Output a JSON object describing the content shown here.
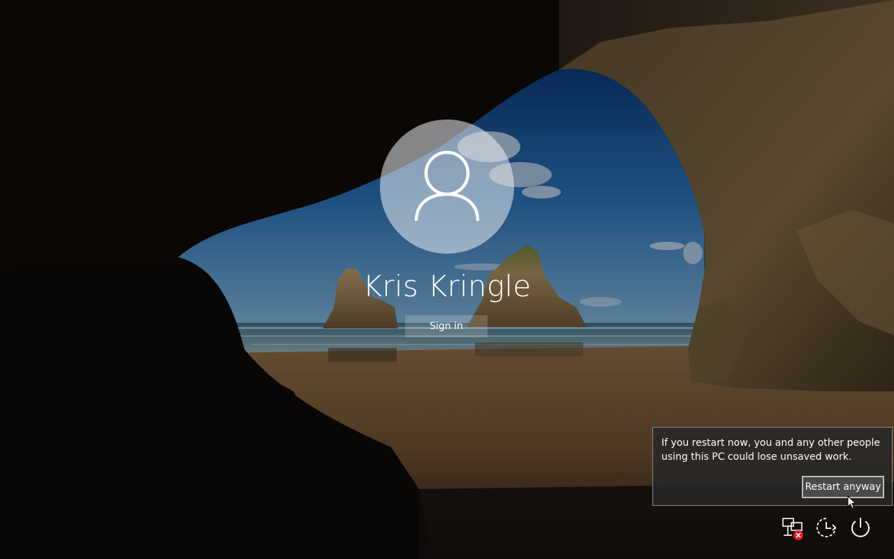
{
  "user": {
    "name": "Kris Kringle"
  },
  "sign_in": {
    "label": "Sign in"
  },
  "restart_warning": {
    "message": "If you restart now, you and any other people using this PC could lose unsaved work.",
    "button_label": "Restart anyway"
  },
  "tray": {
    "network_icon": "network-disconnected-icon",
    "ease_of_access_icon": "ease-of-access-icon",
    "power_icon": "power-icon"
  },
  "colors": {
    "text": "#ffffff",
    "flyout_background": "#282828",
    "flyout_border": "#8a8a8a",
    "error_badge": "#e81123"
  }
}
